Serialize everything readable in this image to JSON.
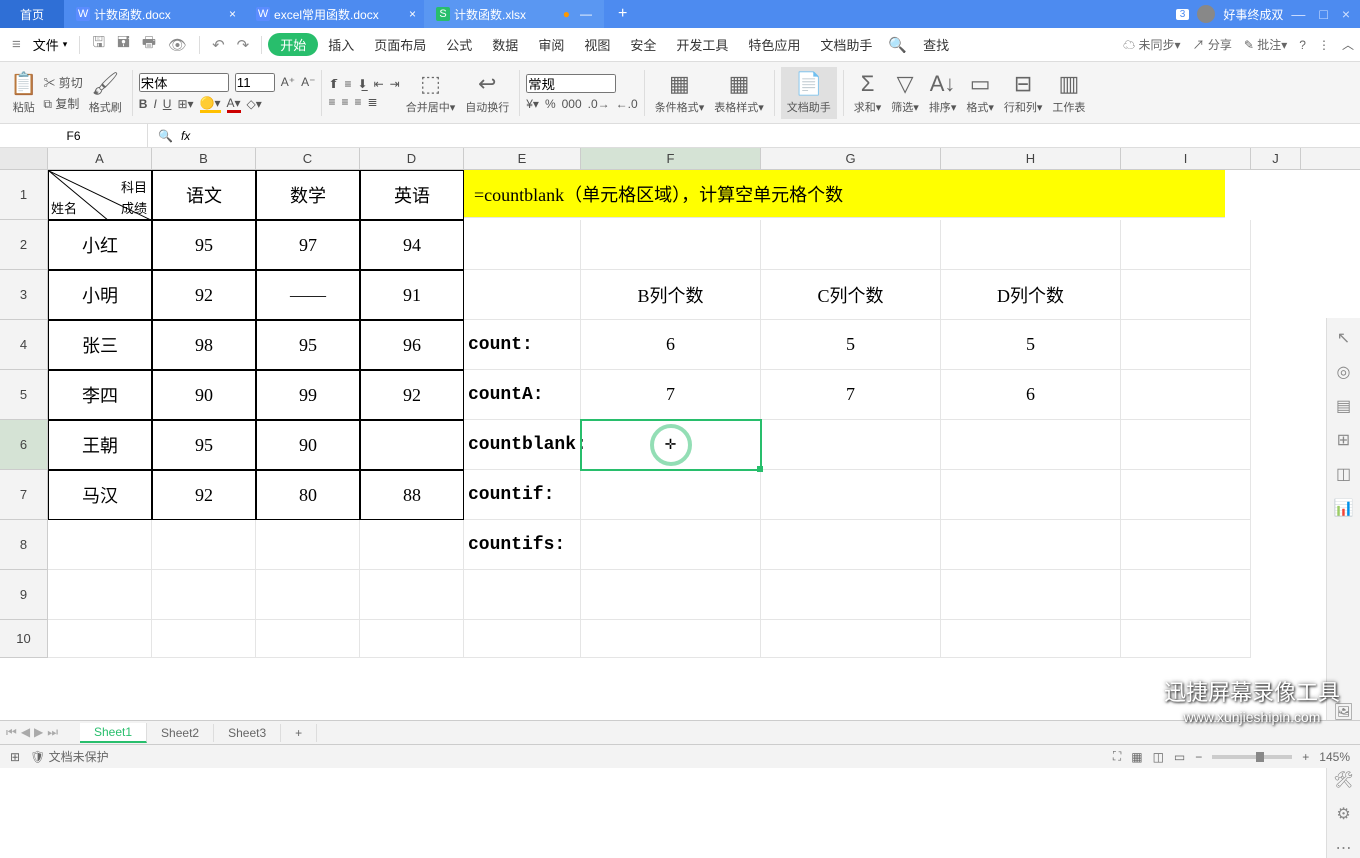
{
  "titlebar": {
    "home": "首页",
    "tabs": [
      {
        "icon": "W",
        "label": "计数函数.docx",
        "active": false
      },
      {
        "icon": "W",
        "label": "excel常用函数.docx",
        "active": false
      },
      {
        "icon": "S",
        "label": "计数函数.xlsx",
        "active": true
      }
    ],
    "badge": "3",
    "username": "好事终成双"
  },
  "menubar": {
    "file": "文件",
    "tabs": [
      "开始",
      "插入",
      "页面布局",
      "公式",
      "数据",
      "审阅",
      "视图",
      "安全",
      "开发工具",
      "特色应用",
      "文档助手"
    ],
    "active_index": 0,
    "search": "查找",
    "sync": "未同步",
    "share": "分享",
    "annotate": "批注"
  },
  "ribbon": {
    "paste": "粘贴",
    "cut": "剪切",
    "copy": "复制",
    "format": "格式刷",
    "font": "宋体",
    "size": "11",
    "merge": "合并居中",
    "wrap": "自动换行",
    "number_format": "常规",
    "cond": "条件格式",
    "table_style": "表格样式",
    "helper": "文档助手",
    "sum": "求和",
    "filter": "筛选",
    "sort": "排序",
    "format_menu": "格式",
    "rowcol": "行和列",
    "worksheet": "工作表"
  },
  "namebox": {
    "cell": "F6",
    "formula": ""
  },
  "grid": {
    "columns": [
      "A",
      "B",
      "C",
      "D",
      "E",
      "F",
      "G",
      "H",
      "I",
      "J"
    ],
    "rows": [
      "1",
      "2",
      "3",
      "4",
      "5",
      "6",
      "7",
      "8",
      "9",
      "10"
    ],
    "a1": {
      "top_right": "科目",
      "bottom_left": "姓名",
      "bottom_right": "成绩"
    },
    "headers": {
      "B": "语文",
      "C": "数学",
      "D": "英语"
    },
    "students": [
      {
        "name": "小红",
        "b": "95",
        "c": "97",
        "d": "94"
      },
      {
        "name": "小明",
        "b": "92",
        "c": "——",
        "d": "91"
      },
      {
        "name": "张三",
        "b": "98",
        "c": "95",
        "d": "96"
      },
      {
        "name": "李四",
        "b": "90",
        "c": "99",
        "d": "92"
      },
      {
        "name": "王朝",
        "b": "95",
        "c": "90",
        "d": ""
      },
      {
        "name": "马汉",
        "b": "92",
        "c": "80",
        "d": "88"
      }
    ],
    "banner": "=countblank（单元格区域），计算空单元格个数",
    "count_headers": {
      "f": "B列个数",
      "g": "C列个数",
      "h": "D列个数"
    },
    "count_rows": [
      {
        "label": "count:",
        "f": "6",
        "g": "5",
        "h": "5"
      },
      {
        "label": "countA:",
        "f": "7",
        "g": "7",
        "h": "6"
      },
      {
        "label": "countblank:",
        "f": "",
        "g": "",
        "h": ""
      },
      {
        "label": "countif:",
        "f": "",
        "g": "",
        "h": ""
      },
      {
        "label": "countifs:",
        "f": "",
        "g": "",
        "h": ""
      }
    ]
  },
  "sheets": [
    "Sheet1",
    "Sheet2",
    "Sheet3"
  ],
  "status": {
    "protect": "文档未保护",
    "zoom": "145%"
  },
  "watermark": {
    "main": "迅捷屏幕录像工具",
    "sub": "www.xunjieshipin.com"
  }
}
